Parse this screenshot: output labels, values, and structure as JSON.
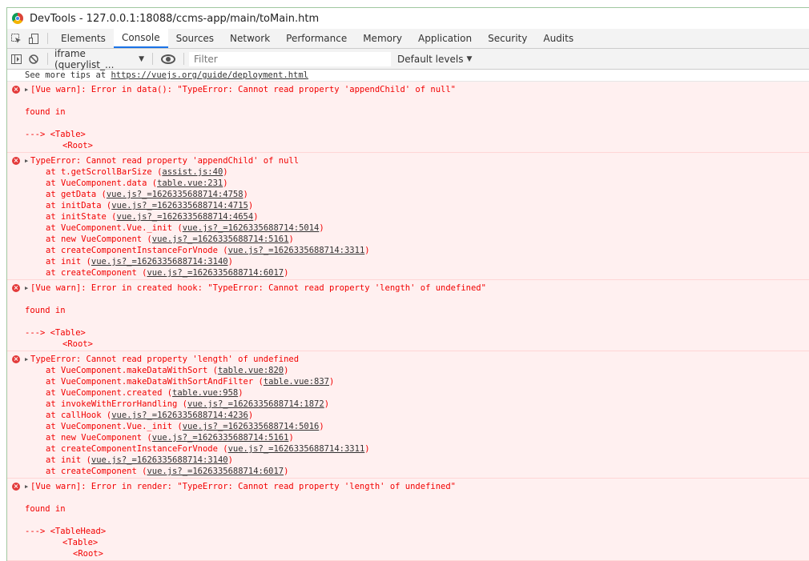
{
  "window": {
    "title": "DevTools - 127.0.0.1:18088/ccms-app/main/toMain.htm"
  },
  "icons": {
    "inspect": "inspect-element-icon",
    "device": "device-toolbar-icon",
    "sidebar": "sidebar-toggle-icon",
    "clear": "clear-console-icon",
    "eye": "live-expression-eye-icon",
    "error": "error-circle-icon",
    "expand": "expand-triangle-icon"
  },
  "tabs": [
    "Elements",
    "Console",
    "Sources",
    "Network",
    "Performance",
    "Memory",
    "Application",
    "Security",
    "Audits"
  ],
  "active_tab": "Console",
  "toolbar": {
    "context": "iframe (querylist_...",
    "filter_placeholder": "Filter",
    "levels": "Default levels"
  },
  "tip": {
    "prefix": "See more tips at ",
    "url": "https://vuejs.org/guide/deployment.html"
  },
  "colors": {
    "error_text": "#f20000",
    "error_bg": "#fff0f0",
    "active_tab": "#1a73e8"
  },
  "messages": [
    {
      "header": "[Vue warn]: Error in data(): \"TypeError: Cannot read property 'appendChild' of null\"",
      "found": "found in",
      "components": [
        "---> <Table>",
        "<Root>"
      ]
    },
    {
      "header": "TypeError: Cannot read property 'appendChild' of null",
      "stack": [
        {
          "fn": "at t.getScrollBarSize (",
          "src": "assist.js:40",
          "end": ")"
        },
        {
          "fn": "at VueComponent.data (",
          "src": "table.vue:231",
          "end": ")"
        },
        {
          "fn": "at getData (",
          "src": "vue.js?_=1626335688714:4758",
          "end": ")"
        },
        {
          "fn": "at initData (",
          "src": "vue.js?_=1626335688714:4715",
          "end": ")"
        },
        {
          "fn": "at initState (",
          "src": "vue.js?_=1626335688714:4654",
          "end": ")"
        },
        {
          "fn": "at VueComponent.Vue._init (",
          "src": "vue.js?_=1626335688714:5014",
          "end": ")"
        },
        {
          "fn": "at new VueComponent (",
          "src": "vue.js?_=1626335688714:5161",
          "end": ")"
        },
        {
          "fn": "at createComponentInstanceForVnode (",
          "src": "vue.js?_=1626335688714:3311",
          "end": ")"
        },
        {
          "fn": "at init (",
          "src": "vue.js?_=1626335688714:3140",
          "end": ")"
        },
        {
          "fn": "at createComponent (",
          "src": "vue.js?_=1626335688714:6017",
          "end": ")"
        }
      ]
    },
    {
      "header": "[Vue warn]: Error in created hook: \"TypeError: Cannot read property 'length' of undefined\"",
      "found": "found in",
      "components": [
        "---> <Table>",
        "<Root>"
      ]
    },
    {
      "header": "TypeError: Cannot read property 'length' of undefined",
      "stack": [
        {
          "fn": "at VueComponent.makeDataWithSort (",
          "src": "table.vue:820",
          "end": ")"
        },
        {
          "fn": "at VueComponent.makeDataWithSortAndFilter (",
          "src": "table.vue:837",
          "end": ")"
        },
        {
          "fn": "at VueComponent.created (",
          "src": "table.vue:958",
          "end": ")"
        },
        {
          "fn": "at invokeWithErrorHandling (",
          "src": "vue.js?_=1626335688714:1872",
          "end": ")"
        },
        {
          "fn": "at callHook (",
          "src": "vue.js?_=1626335688714:4236",
          "end": ")"
        },
        {
          "fn": "at VueComponent.Vue._init (",
          "src": "vue.js?_=1626335688714:5016",
          "end": ")"
        },
        {
          "fn": "at new VueComponent (",
          "src": "vue.js?_=1626335688714:5161",
          "end": ")"
        },
        {
          "fn": "at createComponentInstanceForVnode (",
          "src": "vue.js?_=1626335688714:3311",
          "end": ")"
        },
        {
          "fn": "at init (",
          "src": "vue.js?_=1626335688714:3140",
          "end": ")"
        },
        {
          "fn": "at createComponent (",
          "src": "vue.js?_=1626335688714:6017",
          "end": ")"
        }
      ]
    },
    {
      "header": "[Vue warn]: Error in render: \"TypeError: Cannot read property 'length' of undefined\"",
      "found": "found in",
      "components": [
        "---> <TableHead>",
        "<Table>",
        "<Root>"
      ]
    }
  ]
}
